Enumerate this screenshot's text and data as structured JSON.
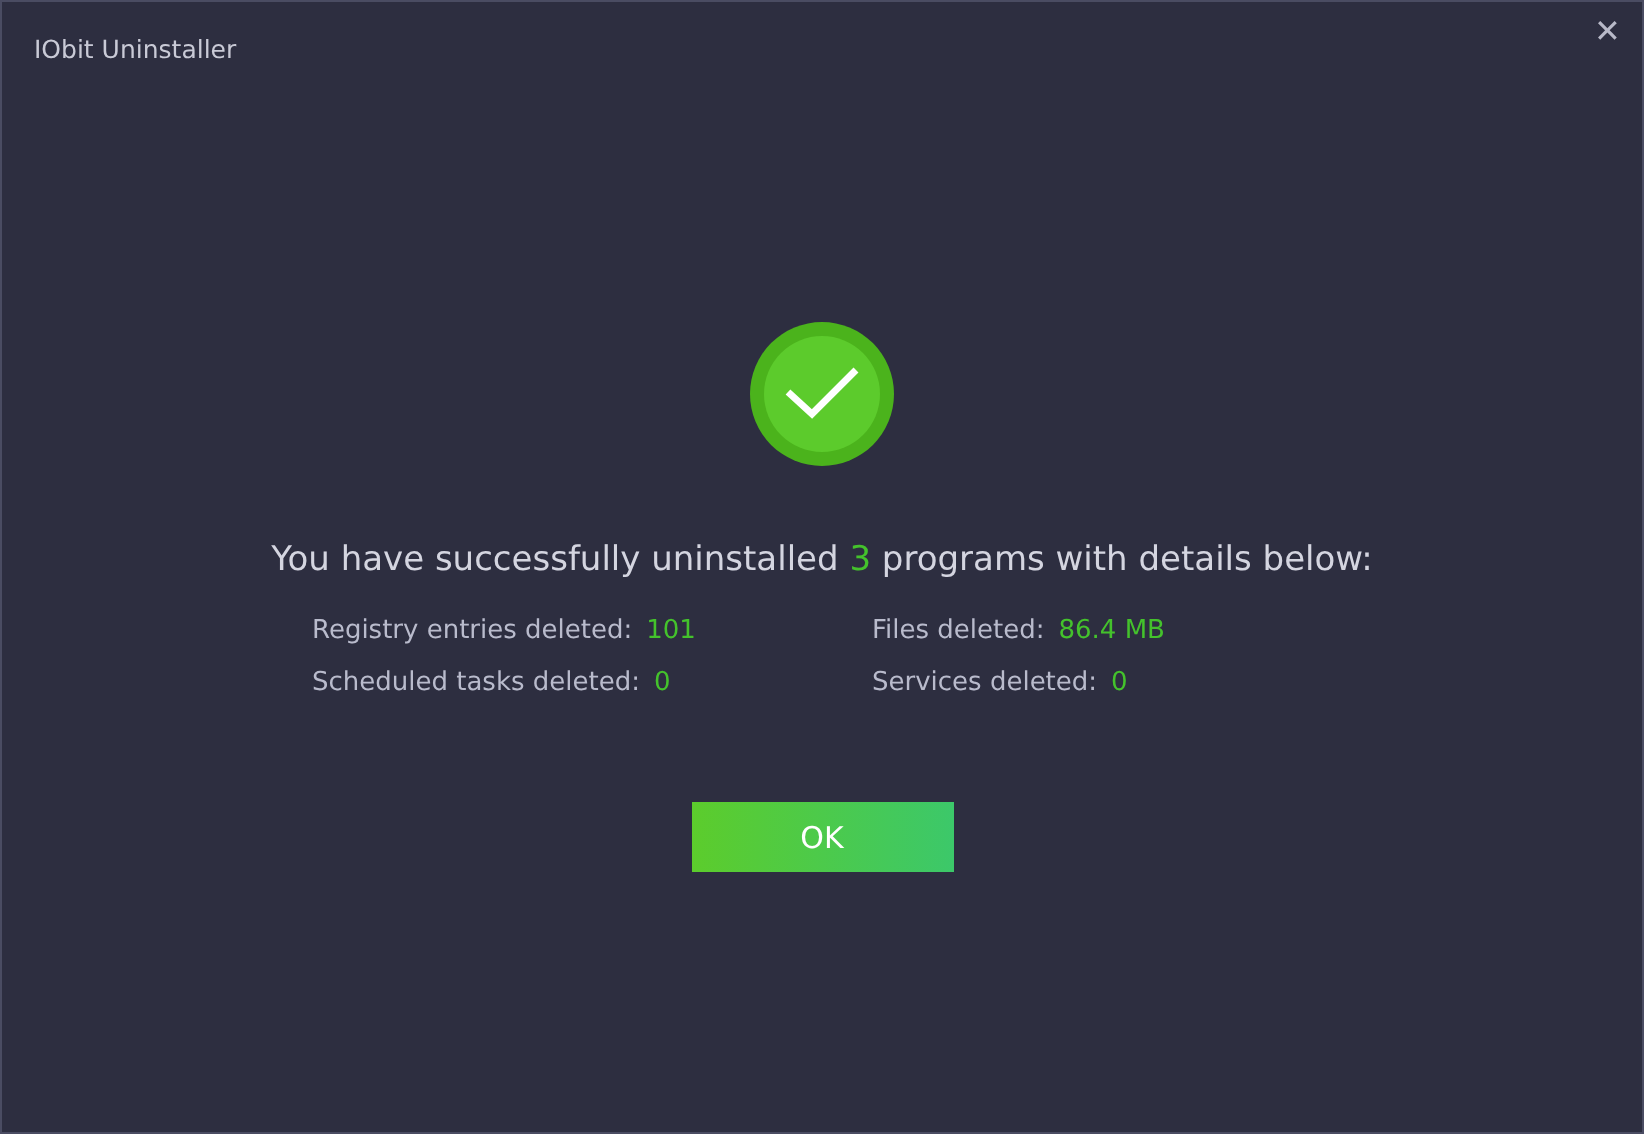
{
  "window": {
    "title": "IObit Uninstaller",
    "close": "✕"
  },
  "result": {
    "succeeded": true,
    "message_before": "You have successfully uninstalled",
    "count": "3",
    "message_after": "programs with details below:"
  },
  "stats": [
    {
      "label": "Registry entries deleted:",
      "value": "101"
    },
    {
      "label": "Files deleted:",
      "value": "86.4 MB"
    },
    {
      "label": "Scheduled tasks deleted:",
      "value": "0"
    },
    {
      "label": "Services deleted:",
      "value": "0"
    }
  ],
  "buttons": [
    "OK"
  ]
}
